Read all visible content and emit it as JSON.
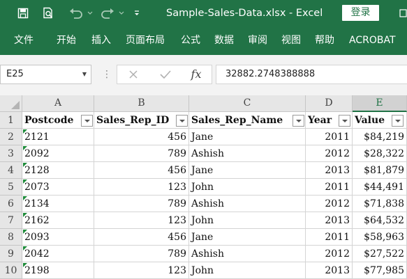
{
  "titlebar": {
    "title": "Sample-Sales-Data.xlsx  -  Excel",
    "login_label": "登录",
    "icons": [
      "save-icon",
      "print-preview-icon",
      "undo-icon",
      "redo-icon",
      "customize-qat-icon"
    ]
  },
  "ribbon": {
    "tabs": [
      {
        "label": "文件"
      },
      {
        "label": "开始"
      },
      {
        "label": "插入"
      },
      {
        "label": "页面布局"
      },
      {
        "label": "公式"
      },
      {
        "label": "数据"
      },
      {
        "label": "审阅"
      },
      {
        "label": "视图"
      },
      {
        "label": "帮助"
      },
      {
        "label": "ACROBAT"
      }
    ]
  },
  "formula_bar": {
    "name_box": "E25",
    "fx_label": "fx",
    "value": "32882.2748388888"
  },
  "sheet": {
    "columns": [
      {
        "letter": "A",
        "header": "Postcode"
      },
      {
        "letter": "B",
        "header": "Sales_Rep_ID"
      },
      {
        "letter": "C",
        "header": "Sales_Rep_Name"
      },
      {
        "letter": "D",
        "header": "Year"
      },
      {
        "letter": "E",
        "header": "Value"
      }
    ],
    "selected_column": "E",
    "rows": [
      {
        "num": "1"
      },
      {
        "num": "2",
        "cells": [
          "2121",
          "456",
          "Jane",
          "2011",
          "$84,219"
        ]
      },
      {
        "num": "3",
        "cells": [
          "2092",
          "789",
          "Ashish",
          "2012",
          "$28,322"
        ]
      },
      {
        "num": "4",
        "cells": [
          "2128",
          "456",
          "Jane",
          "2013",
          "$81,879"
        ]
      },
      {
        "num": "5",
        "cells": [
          "2073",
          "123",
          "John",
          "2011",
          "$44,491"
        ]
      },
      {
        "num": "6",
        "cells": [
          "2134",
          "789",
          "Ashish",
          "2012",
          "$71,838"
        ]
      },
      {
        "num": "7",
        "cells": [
          "2162",
          "123",
          "John",
          "2013",
          "$64,532"
        ]
      },
      {
        "num": "8",
        "cells": [
          "2093",
          "456",
          "Jane",
          "2011",
          "$58,963"
        ]
      },
      {
        "num": "9",
        "cells": [
          "2042",
          "789",
          "Ashish",
          "2012",
          "$27,522"
        ]
      },
      {
        "num": "10",
        "cells": [
          "2198",
          "123",
          "John",
          "2013",
          "$77,985"
        ]
      }
    ]
  },
  "colors": {
    "excel_green": "#217346",
    "error_flag": "#1e8c3a"
  }
}
